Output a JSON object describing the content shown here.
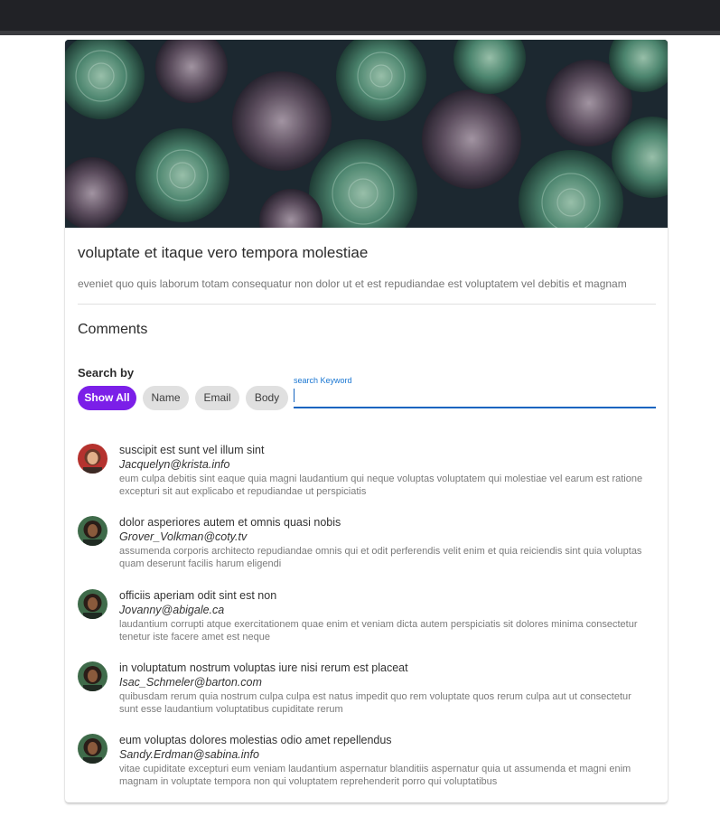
{
  "post": {
    "title": "voluptate et itaque vero tempora molestiae",
    "body": "eveniet quo quis laborum totam consequatur non dolor ut et est repudiandae est voluptatem vel debitis et magnam"
  },
  "comments_section": {
    "heading": "Comments",
    "search_by_label": "Search by",
    "filters": [
      "Show All",
      "Name",
      "Email",
      "Body"
    ],
    "active_filter": "Show All",
    "search": {
      "label": "search Keyword",
      "value": ""
    }
  },
  "comments": [
    {
      "name": "suscipit est sunt vel illum sint",
      "email": "Jacquelyn@krista.info",
      "body": "eum culpa debitis sint eaque quia magni laudantium qui neque voluptas voluptatem qui molestiae vel earum est ratione excepturi sit aut explicabo et repudiandae ut perspiciatis"
    },
    {
      "name": "dolor asperiores autem et omnis quasi nobis",
      "email": "Grover_Volkman@coty.tv",
      "body": "assumenda corporis architecto repudiandae omnis qui et odit perferendis velit enim et quia reiciendis sint quia voluptas quam deserunt facilis harum eligendi"
    },
    {
      "name": "officiis aperiam odit sint est non",
      "email": "Jovanny@abigale.ca",
      "body": "laudantium corrupti atque exercitationem quae enim et veniam dicta autem perspiciatis sit dolores minima consectetur tenetur iste facere amet est neque"
    },
    {
      "name": "in voluptatum nostrum voluptas iure nisi rerum est placeat",
      "email": "Isac_Schmeler@barton.com",
      "body": "quibusdam rerum quia nostrum culpa culpa est natus impedit quo rem voluptate quos rerum culpa aut ut consectetur sunt esse laudantium voluptatibus cupiditate rerum"
    },
    {
      "name": "eum voluptas dolores molestias odio amet repellendus",
      "email": "Sandy.Erdman@sabina.info",
      "body": "vitae cupiditate excepturi eum veniam laudantium aspernatur blanditiis aspernatur quia ut assumenda et magni enim magnam in voluptate tempora non qui voluptatem reprehenderit porro qui voluptatibus"
    }
  ],
  "colors": {
    "accent": "#7b1fe8",
    "input_underline": "#1565c0",
    "topbar": "#212226"
  }
}
